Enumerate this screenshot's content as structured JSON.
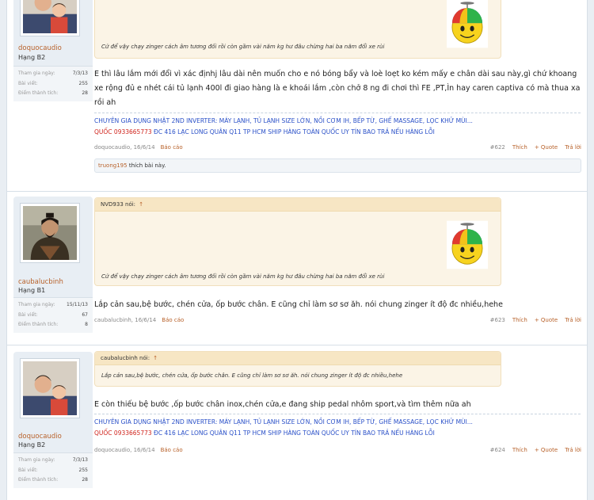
{
  "quote_text_1": "Cứ để vậy chạy zinger cách âm tương đối rồi còn gầm vài năm kg hư đâu chừng hai ba năm đổi xe rùi",
  "posts": [
    {
      "username": "doquocaudio",
      "rank": "Hạng B2",
      "stats": [
        {
          "label": "Tham gia ngày:",
          "value": "7/3/13"
        },
        {
          "label": "Bài viết:",
          "value": "255"
        },
        {
          "label": "Điểm thành tích:",
          "value": "28"
        }
      ],
      "message": "E thì lâu lắm mới đổi vì xác địnhj lâu dài nên muốn cho e nó bóng bẩy và loè loẹt ko kém mấy e chân dài sau này,gì chứ khoang xe rộng đủ e nhét cái tủ lạnh 400l đi giao hàng là e khoái lắm ,còn chở 8 ng đi chơi thì FE ,PT,Ìn hay caren captiva có mà thua xa rồi ah",
      "sig_line1": "CHUYÊN GIA DỤNG NHẬT 2ND INVERTER: MÁY LẠNH, TỦ LẠNH SIZE LỚN, NỒI CƠM IH, BẾP TỪ, GHẾ MASSAGE, LỌC KHỬ MÙI...",
      "sig_phone": "QUỐC 0933665773",
      "sig_line2": " ĐC 416 LẠC LONG QUÂN Q11 TP HCM SHIP HÀNG TOÀN QUỐC UY TÍN BAO TRẢ NẾU HÀNG LỖI",
      "meta_author": "doquocaudio,",
      "meta_date": "16/6/14",
      "report": "Báo cáo",
      "post_num": "#622",
      "like": "Thích",
      "quote": "+ Quote",
      "reply": "Trả lời",
      "liker": "truong195",
      "liked_text": " thích bài này."
    },
    {
      "username": "caubalucbinh",
      "rank": "Hạng B1",
      "stats": [
        {
          "label": "Tham gia ngày:",
          "value": "15/11/13"
        },
        {
          "label": "Bài viết:",
          "value": "67"
        },
        {
          "label": "Điểm thành tích:",
          "value": "8"
        }
      ],
      "quote_author": "NVD933 nói:",
      "quote_arrow": "↑",
      "message": "Lắp cản sau,bệ bước, chén cửa, ốp bước chân. E cũng chỉ làm sơ sơ ăh. nói chung zinger ít độ đc nhiều,hehe",
      "meta_author": "caubalucbinh,",
      "meta_date": "16/6/14",
      "report": "Báo cáo",
      "post_num": "#623",
      "like": "Thích",
      "quote": "+ Quote",
      "reply": "Trả lời"
    },
    {
      "username": "doquocaudio",
      "rank": "Hạng B2",
      "stats": [
        {
          "label": "Tham gia ngày:",
          "value": "7/3/13"
        },
        {
          "label": "Bài viết:",
          "value": "255"
        },
        {
          "label": "Điểm thành tích:",
          "value": "28"
        }
      ],
      "quote_author": "caubalucbinh nói:",
      "quote_arrow": "↑",
      "quote_text": "Lắp cản sau,bệ bước, chén cửa, ốp bước chân. E cũng chỉ làm sơ sơ ăh. nói chung zinger ít độ đc nhiều,hehe",
      "message": "E còn thiếu bệ bước ,ốp bước chân inox,chén cửa,e đang ship pedal nhôm sport,và tìm thêm nữa ah",
      "sig_line1": "CHUYÊN GIA DỤNG NHẬT 2ND INVERTER: MÁY LẠNH, TỦ LẠNH SIZE LỚN, NỒI CƠM IH, BẾP TỪ, GHẾ MASSAGE, LỌC KHỬ MÙI...",
      "sig_phone": "QUỐC 0933665773",
      "sig_line2": " ĐC 416 LẠC LONG QUÂN Q11 TP HCM SHIP HÀNG TOÀN QUỐC UY TÍN BAO TRẢ NẾU HÀNG LỖI",
      "meta_author": "doquocaudio,",
      "meta_date": "16/6/14",
      "report": "Báo cáo",
      "post_num": "#624",
      "like": "Thích",
      "quote": "+ Quote",
      "reply": "Trả lời"
    }
  ]
}
